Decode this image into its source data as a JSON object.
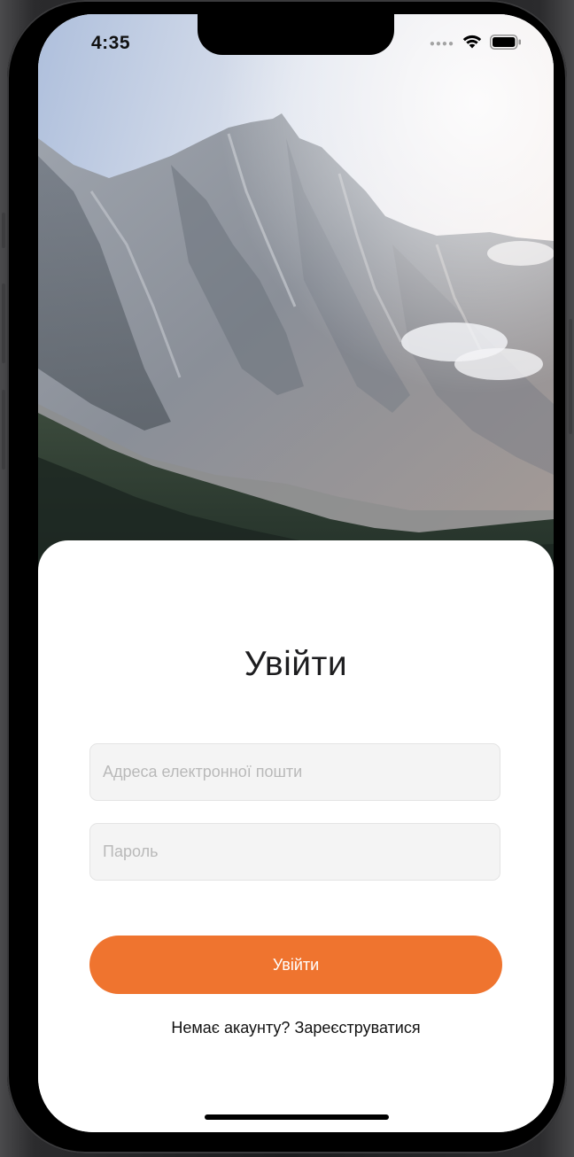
{
  "status_bar": {
    "time": "4:35",
    "signal_icon": "signal-dots-icon",
    "wifi_icon": "wifi-icon",
    "battery_icon": "battery-icon"
  },
  "hero": {
    "image": "mountain-landscape-photo"
  },
  "login": {
    "title": "Увійти",
    "email_placeholder": "Адреса електронної пошти",
    "email_value": "",
    "password_placeholder": "Пароль",
    "password_value": "",
    "submit_label": "Увійти",
    "signup_link": "Немає акаунту? Зареєструватися"
  },
  "colors": {
    "accent": "#ef742f",
    "field_background": "#f4f4f4",
    "placeholder": "#b9b9b9"
  }
}
